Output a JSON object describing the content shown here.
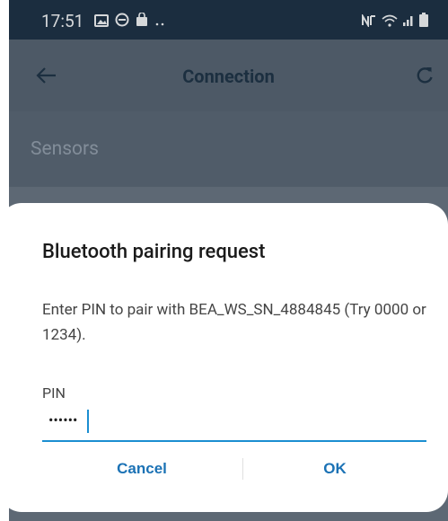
{
  "status_bar": {
    "time": "17:51",
    "left_icons": [
      "image-icon",
      "do-not-disturb-icon",
      "bag-icon",
      "more-dots-icon"
    ],
    "right_icons": [
      "nfc-icon",
      "wifi-icon",
      "signal-icon",
      "battery-icon"
    ]
  },
  "app_bar": {
    "title": "Connection",
    "back_icon": "arrow-left-icon",
    "refresh_icon": "refresh-icon"
  },
  "content": {
    "section_title": "Sensors"
  },
  "dialog": {
    "title": "Bluetooth pairing request",
    "message": "Enter PIN to pair with BEA_WS_SN_4884845 (Try 0000 or 1234).",
    "pin_label": "PIN",
    "pin_value": "••••••",
    "cancel_label": "Cancel",
    "ok_label": "OK"
  },
  "colors": {
    "status_bar_bg": "#0e2235",
    "app_bar_bg": "#4b5764",
    "accent": "#1b72b5",
    "input_underline": "#1b8ed1"
  }
}
